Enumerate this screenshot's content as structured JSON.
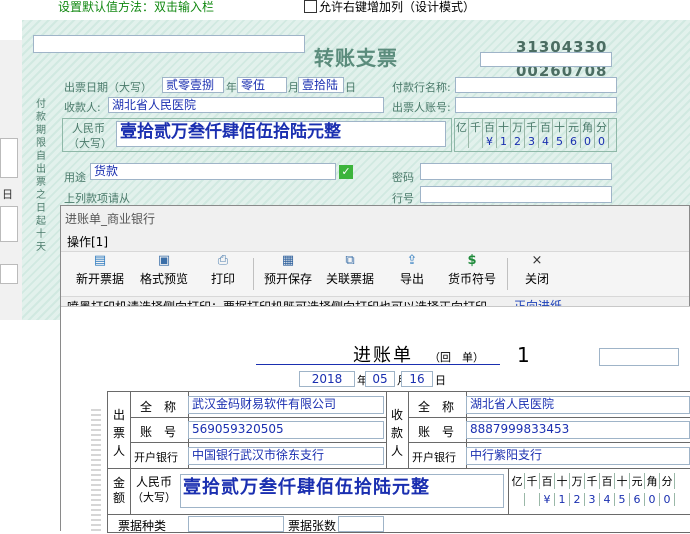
{
  "top_hint": "设置默认值方法：双击输入栏",
  "checkbox_label": "允许右键增加列（设计模式）",
  "cheque": {
    "title": "转账支票",
    "number_top": "31304330",
    "number_bottom": "00260708",
    "side_text": "付款期限自出票之日起十天",
    "date_label": "出票日期（大写）",
    "year": "贰零壹捌",
    "year_unit": "年",
    "month": "零伍",
    "month_unit": "月",
    "day": "壹拾陆",
    "day_unit": "日",
    "payer_bank_label": "付款行名称:",
    "payee_label": "收款人:",
    "payee_value": "湖北省人民医院",
    "drawer_account_label": "出票人账号:",
    "rmb_label": "人民币",
    "upper_label": "（大写）",
    "amount_upper": "壹拾贰万叁仟肆佰伍拾陆元整",
    "units": [
      "亿",
      "千",
      "百",
      "十",
      "万",
      "千",
      "百",
      "十",
      "元",
      "角",
      "分"
    ],
    "digits": [
      "",
      "",
      "¥",
      "1",
      "2",
      "3",
      "4",
      "5",
      "6",
      "0",
      "0"
    ],
    "purpose_label": "用途",
    "purpose_value": "货款",
    "password_label": "密码",
    "above_label": "上列款项请从",
    "line_label": "行号",
    "left_glyph": "日"
  },
  "window": {
    "title": "进账单_商业银行",
    "menu": "操作[1]",
    "toolbar": [
      {
        "label": "新开票据",
        "icon": "new-ticket-icon"
      },
      {
        "label": "格式预览",
        "icon": "preview-icon"
      },
      {
        "label": "打印",
        "icon": "printer-icon"
      },
      {
        "label": "预开保存",
        "icon": "save-icon"
      },
      {
        "label": "关联票据",
        "icon": "link-tickets-icon"
      },
      {
        "label": "导出",
        "icon": "export-icon"
      },
      {
        "label": "货币符号",
        "icon": "dollar-icon"
      },
      {
        "label": "关闭",
        "icon": "close-icon"
      }
    ],
    "notice": "喷墨打印机请选择侧向打印；票据打印机既可选择侧向打印也可以选择正向打印。",
    "feed_link": "正向进纸",
    "slip": {
      "title": "进账单",
      "subtitle": "（回　单）",
      "copy_no": "1",
      "year": "2018",
      "year_unit": "年",
      "month": "05",
      "month_unit": "月",
      "day": "16",
      "day_unit": "日",
      "drawer_label": "出票人",
      "payee_label": "收款人",
      "name_label": "全　称",
      "account_label": "账　号",
      "bank_label": "开户银行",
      "drawer_name": "武汉金码财易软件有限公司",
      "drawer_account": "569059320505",
      "drawer_bank": "中国银行武汉市徐东支行",
      "payee_name": "湖北省人民医院",
      "payee_account": "8887999833453",
      "payee_bank": "中行紫阳支行",
      "amount_label": "金额",
      "rmb_label": "人民币",
      "upper_label": "（大写）",
      "amount_upper": "壹拾贰万叁仟肆佰伍拾陆元整",
      "units": [
        "亿",
        "千",
        "百",
        "十",
        "万",
        "千",
        "百",
        "十",
        "元",
        "角",
        "分"
      ],
      "digits": [
        "",
        "",
        "¥",
        "1",
        "2",
        "3",
        "4",
        "5",
        "6",
        "0",
        "0"
      ],
      "ticket_type_label": "票据种类",
      "ticket_count_label": "票据张数"
    }
  }
}
